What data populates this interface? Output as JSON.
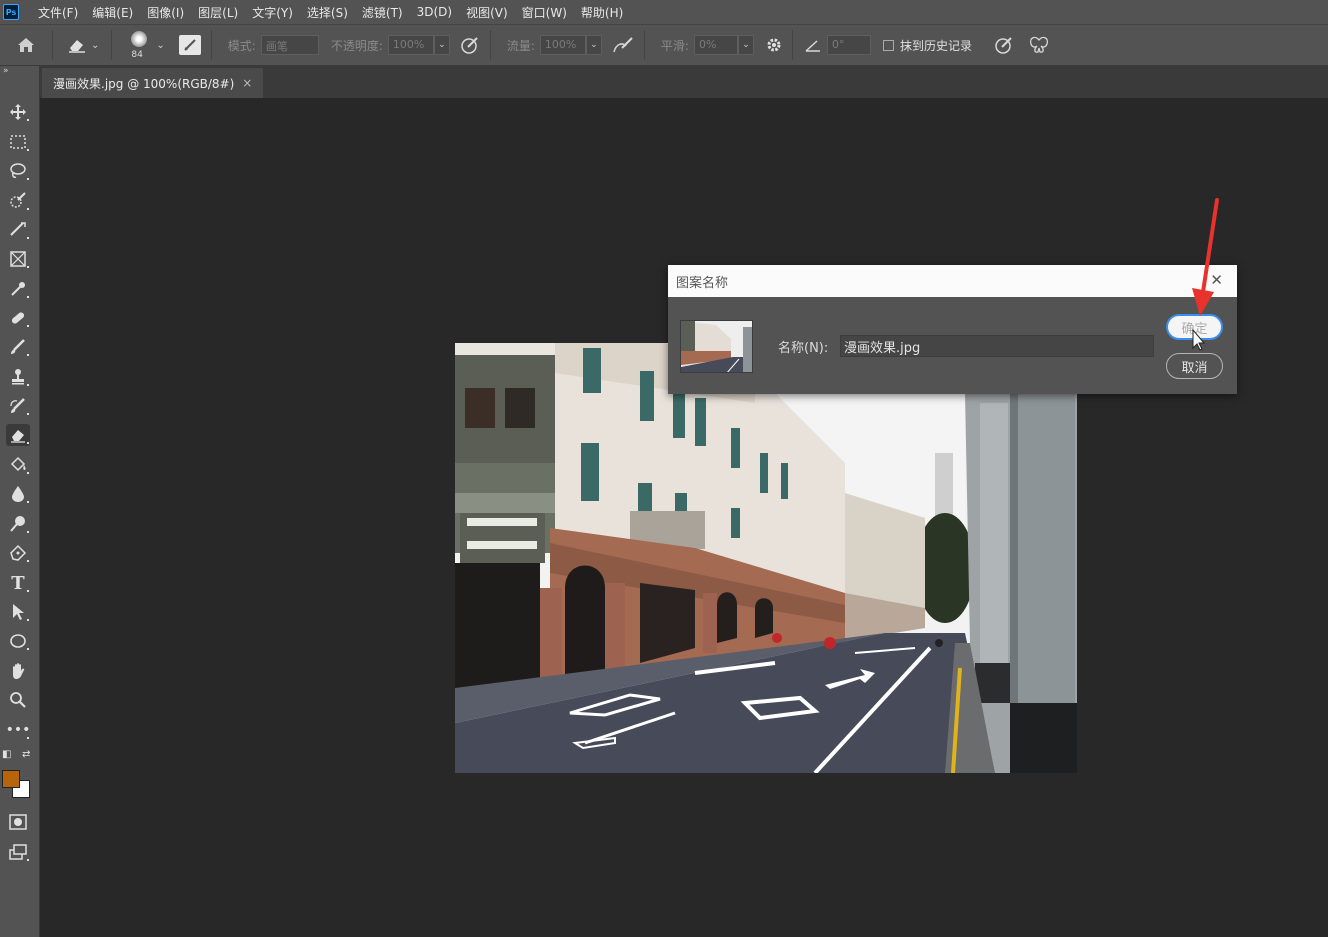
{
  "app": {
    "logo": "Ps"
  },
  "menu": [
    "文件(F)",
    "编辑(E)",
    "图像(I)",
    "图层(L)",
    "文字(Y)",
    "选择(S)",
    "滤镜(T)",
    "3D(D)",
    "视图(V)",
    "窗口(W)",
    "帮助(H)"
  ],
  "options": {
    "brush_size": "84",
    "mode_label": "模式:",
    "mode_value": "画笔",
    "opacity_label": "不透明度:",
    "opacity_value": "100%",
    "flow_label": "流量:",
    "flow_value": "100%",
    "smoothing_label": "平滑:",
    "smoothing_value": "0%",
    "angle_value": "0°",
    "erase_history_label": "抹到历史记录"
  },
  "document_tab": {
    "title": "漫画效果.jpg @ 100%(RGB/8#)",
    "close": "×"
  },
  "colors": {
    "foreground": "#b7640a",
    "background": "#ffffff",
    "accent": "#3a8eed",
    "annotation": "#e8322c"
  },
  "dialog": {
    "title": "图案名称",
    "close": "✕",
    "name_label": "名称(N):",
    "name_value": "漫画效果.jpg",
    "ok_label": "确定",
    "cancel_label": "取消"
  }
}
